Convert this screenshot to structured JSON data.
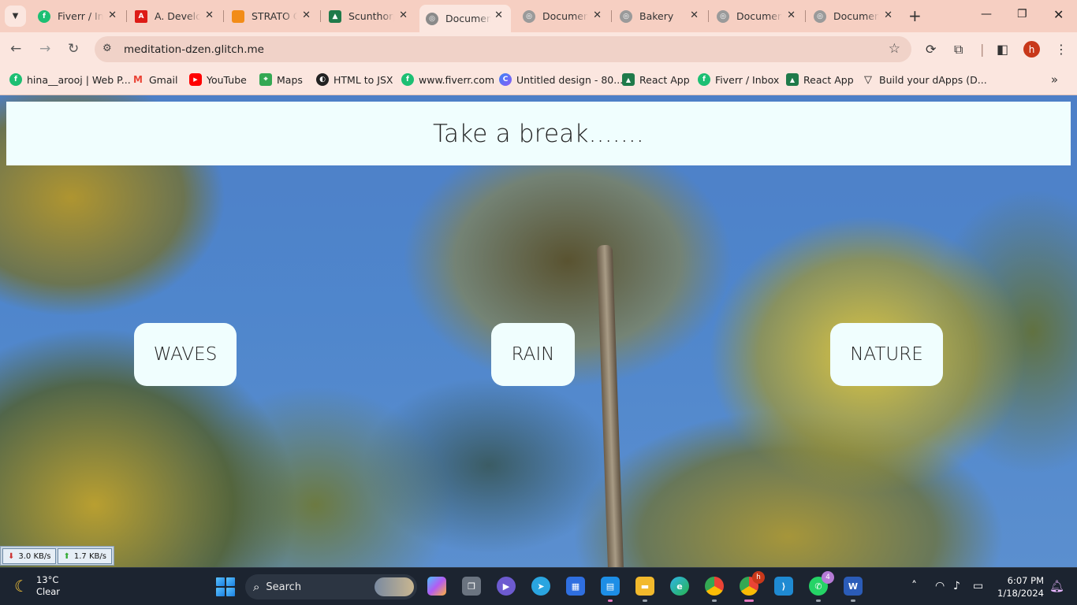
{
  "browser": {
    "tabs": [
      {
        "label": "Fiverr / Inbox",
        "icon": "fiverr-icon",
        "color": "#1dbf73",
        "active": false
      },
      {
        "label": "A. Developer",
        "icon": "angular-icon",
        "color": "#dd1b16",
        "active": false
      },
      {
        "label": "STRATO Cloud",
        "icon": "strato-icon",
        "color": "#f28c18",
        "active": false
      },
      {
        "label": "Scunthorpe",
        "icon": "react-app-icon",
        "color": "#1f7a4a",
        "active": false
      },
      {
        "label": "Document",
        "icon": "globe-icon",
        "color": "#8a8a8a",
        "active": true
      },
      {
        "label": "Document",
        "icon": "globe-icon",
        "color": "#8a8a8a",
        "active": false
      },
      {
        "label": "Bakery",
        "icon": "globe-icon",
        "color": "#8a8a8a",
        "active": false
      },
      {
        "label": "Document",
        "icon": "globe-icon",
        "color": "#8a8a8a",
        "active": false
      },
      {
        "label": "Document",
        "icon": "globe-icon",
        "color": "#8a8a8a",
        "active": false
      }
    ],
    "url": "meditation-dzen.glitch.me",
    "profile_initial": "h",
    "bookmarks": [
      {
        "label": "hina__arooj | Web P...",
        "icon": "fiverr-icon",
        "color": "#1dbf73"
      },
      {
        "label": "Gmail",
        "icon": "gmail-icon",
        "color": "#ea4335"
      },
      {
        "label": "YouTube",
        "icon": "youtube-icon",
        "color": "#ff0000"
      },
      {
        "label": "Maps",
        "icon": "maps-icon",
        "color": "#34a853"
      },
      {
        "label": "HTML to JSX",
        "icon": "html-to-jsx-icon",
        "color": "#222222"
      },
      {
        "label": "www.fiverr.com",
        "icon": "fiverr-icon",
        "color": "#1dbf73"
      },
      {
        "label": "Untitled design - 80...",
        "icon": "canva-icon",
        "color": "#3b82f6"
      },
      {
        "label": "React App",
        "icon": "react-app-icon",
        "color": "#1f7a4a"
      },
      {
        "label": "Fiverr / Inbox",
        "icon": "fiverr-icon",
        "color": "#1dbf73"
      },
      {
        "label": "React App",
        "icon": "react-app-icon",
        "color": "#1f7a4a"
      },
      {
        "label": "Build your dApps (D...",
        "icon": "dapps-icon",
        "color": "#222222"
      }
    ]
  },
  "page": {
    "heading": "Take a break.......",
    "buttons": [
      {
        "label": "WAVES"
      },
      {
        "label": "RAIN"
      },
      {
        "label": "NATURE"
      }
    ]
  },
  "netmeter": {
    "download": "3.0 KB/s",
    "upload": "1.7 KB/s"
  },
  "taskbar": {
    "weather_temp": "13°C",
    "weather_desc": "Clear",
    "search_label": "Search",
    "apps": [
      {
        "name": "copilot-icon",
        "badge": ""
      },
      {
        "name": "task-view-icon",
        "badge": ""
      },
      {
        "name": "video-call-icon",
        "badge": ""
      },
      {
        "name": "telegram-icon",
        "badge": ""
      },
      {
        "name": "store-icon",
        "badge": ""
      },
      {
        "name": "notes-icon",
        "badge": ""
      },
      {
        "name": "file-explorer-icon",
        "badge": ""
      },
      {
        "name": "edge-icon",
        "badge": ""
      },
      {
        "name": "chrome-icon",
        "badge": ""
      },
      {
        "name": "chrome-profile-icon",
        "badge": "h"
      },
      {
        "name": "vscode-icon",
        "badge": ""
      },
      {
        "name": "whatsapp-icon",
        "badge": "4"
      },
      {
        "name": "word-icon",
        "badge": ""
      }
    ],
    "time": "6:07 PM",
    "date": "1/18/2024"
  }
}
